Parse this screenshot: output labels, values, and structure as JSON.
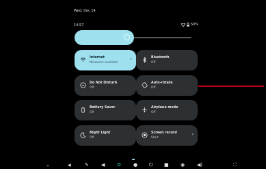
{
  "status": {
    "date": "Wed, Dec 14",
    "time": "14:57",
    "battery": "50%"
  },
  "tiles": [
    {
      "title": "Internet",
      "subtitle": "Networks available",
      "active": true,
      "icon": "wifi-icon"
    },
    {
      "title": "Bluetooth",
      "subtitle": "Off",
      "active": false,
      "icon": "bluetooth-icon"
    },
    {
      "title": "Do Not Disturb",
      "subtitle": "Off",
      "active": false,
      "icon": "do-not-disturb-icon"
    },
    {
      "title": "Auto-rotate",
      "subtitle": "Off",
      "active": false,
      "icon": "auto-rotate-icon"
    },
    {
      "title": "Battery Saver",
      "subtitle": "Off",
      "active": false,
      "icon": "battery-saver-icon"
    },
    {
      "title": "Airplane mode",
      "subtitle": "Off",
      "active": false,
      "icon": "airplane-icon"
    },
    {
      "title": "Night Light",
      "subtitle": "Off",
      "active": false,
      "icon": "night-light-icon"
    },
    {
      "title": "Screen record",
      "subtitle": "Start",
      "active": false,
      "icon": "screen-record-icon"
    }
  ],
  "brightness": {
    "level": 0.5
  },
  "colors": {
    "accent": "#9fe0ee",
    "tile": "#2d3033",
    "background": "#000000"
  }
}
